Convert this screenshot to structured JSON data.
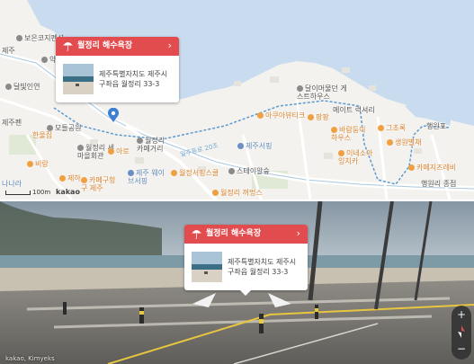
{
  "map": {
    "scale_label": "100m",
    "logo": "kakao",
    "road_label": "일주동로 20조",
    "pois": [
      {
        "id": "boeun",
        "label": "보은코지펜션",
        "style": "dark"
      },
      {
        "id": "yakguk",
        "label": "약국",
        "style": "dark"
      },
      {
        "id": "dalbit",
        "label": "달빛인연",
        "style": "dark"
      },
      {
        "id": "jeju1",
        "label": "제주",
        "style": "dark"
      },
      {
        "id": "modeul",
        "label": "모들공원",
        "style": "dark"
      },
      {
        "id": "hanyang",
        "label": "한울집",
        "style": "orange"
      },
      {
        "id": "jejupension",
        "label": "제주펜",
        "style": "dark"
      },
      {
        "id": "woljeong_hall",
        "label": "월정리 세마을회관",
        "style": "dark"
      },
      {
        "id": "woljeong_beach",
        "label": "월정리 카페거리",
        "style": "dark"
      },
      {
        "id": "cafe_harbor",
        "label": "카페구항구 제주",
        "style": "orange"
      },
      {
        "id": "jeha",
        "label": "제하",
        "style": "orange"
      },
      {
        "id": "birang",
        "label": "비랑",
        "style": "orange"
      },
      {
        "id": "nanara",
        "label": "나나라",
        "style": "blue"
      },
      {
        "id": "aleum",
        "label": "아로",
        "style": "orange"
      },
      {
        "id": "guesthouse",
        "label": "달이머물던 게스트하우스",
        "style": "dark"
      },
      {
        "id": "aqua",
        "label": "아쿠아뷰티크",
        "style": "orange"
      },
      {
        "id": "pankeyo",
        "label": "팡팡",
        "style": "orange"
      },
      {
        "id": "barami",
        "label": "바람둥이 하우스",
        "style": "orange"
      },
      {
        "id": "cheonsa",
        "label": "제주서핑",
        "style": "blue"
      },
      {
        "id": "starbucks",
        "label": "스테이알숲",
        "style": "dark"
      },
      {
        "id": "wolhouse",
        "label": "월정서핑스쿨",
        "style": "orange"
      },
      {
        "id": "waves",
        "label": "제주 웨이브서핑",
        "style": "blue"
      },
      {
        "id": "woljeong_ggori",
        "label": "월정리 꺼멍스",
        "style": "orange"
      },
      {
        "id": "marine",
        "label": "그초록",
        "style": "orange"
      },
      {
        "id": "saengwol",
        "label": "생원별채",
        "style": "orange"
      },
      {
        "id": "haengwon",
        "label": "행원포",
        "style": "dark"
      },
      {
        "id": "cafe_jeju",
        "label": "카페지즈레비",
        "style": "orange"
      },
      {
        "id": "inaesoa",
        "label": "이네소아 잉치카",
        "style": "orange"
      },
      {
        "id": "haengwonri",
        "label": "행원리 종점",
        "style": "dark"
      },
      {
        "id": "peace",
        "label": "메이트 럭셔리",
        "style": "dark"
      }
    ]
  },
  "card": {
    "title": "월정리 해수욕장",
    "address": "제주특별자치도 제주시 구좌읍 월정리 33-3",
    "chevron": "›"
  },
  "roadview": {
    "credit": "kakao, Kimyeks",
    "zoom_in": "+",
    "zoom_out": "−"
  },
  "icons": {
    "umbrella": "umbrella-icon",
    "pin": "map-pin-icon",
    "compass": "compass-icon"
  },
  "colors": {
    "card_header": "#e34c4f",
    "sea": "#c9dcef",
    "land": "#f4f2ee"
  }
}
